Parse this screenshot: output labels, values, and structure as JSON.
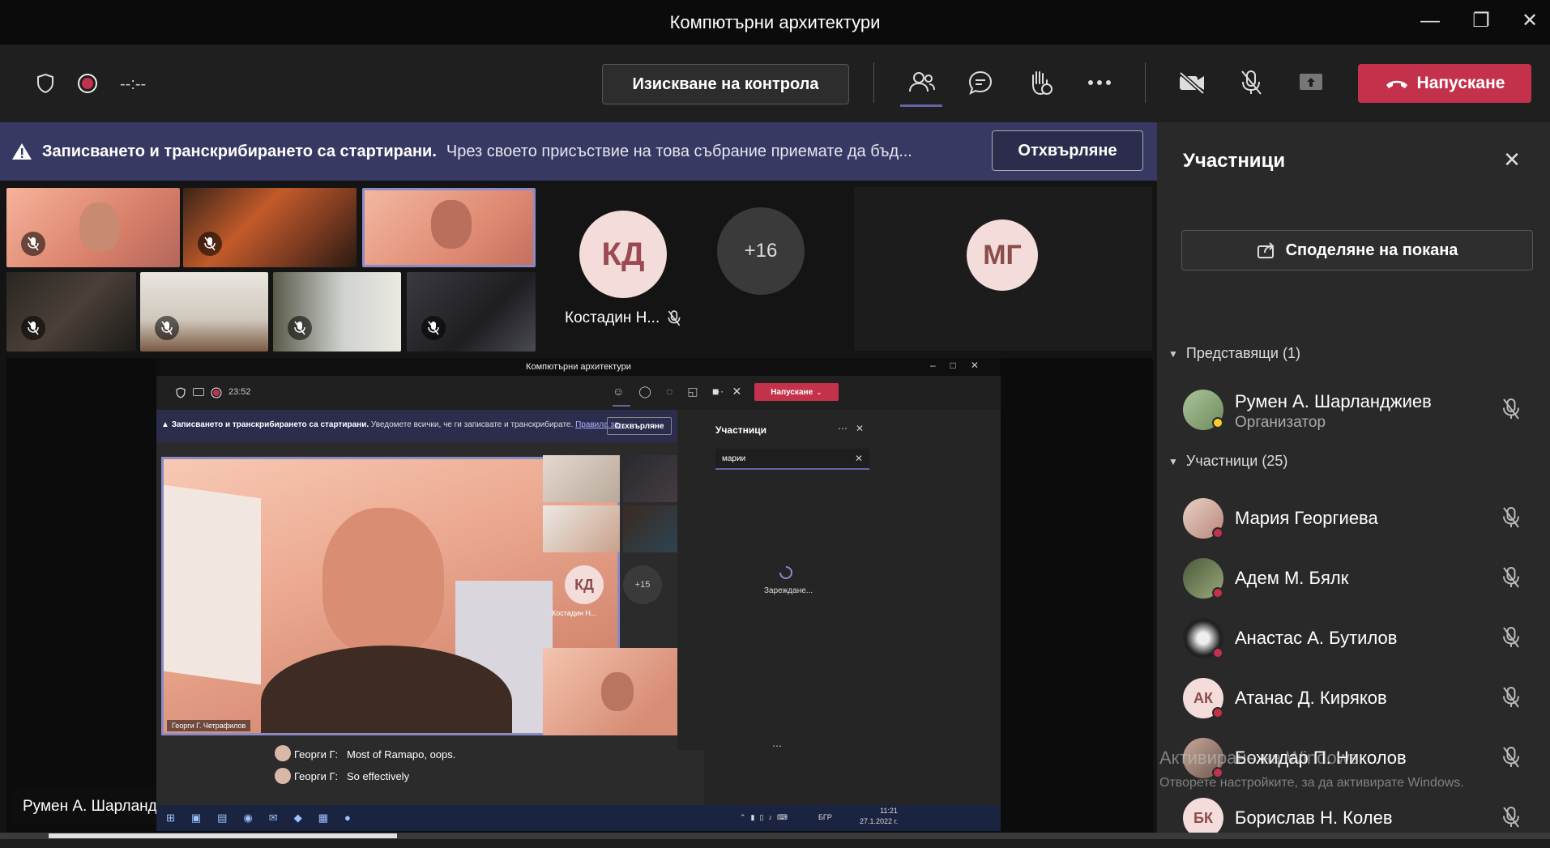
{
  "window": {
    "title": "Компютърни архитектури",
    "minimize": "—",
    "maximize": "❐",
    "close": "✕"
  },
  "toolbar": {
    "timer": "--:--",
    "request_control": "Изискване на контрола",
    "leave": "Напускане"
  },
  "banner": {
    "bold": "Записването и транскрибирането са стартирани.",
    "text": "Чрез своето присъствие на това събрание приемате да бъд...",
    "dismiss": "Отхвърляне"
  },
  "stage": {
    "avatars": [
      {
        "initials": "КД",
        "name": "Костадин Н..."
      },
      {
        "initials": "+16"
      },
      {
        "initials": "МГ"
      }
    ],
    "presenter_name": "Румен А. Шарланджиев"
  },
  "shared": {
    "title": "Компютърни архитектури",
    "timer": "23:52",
    "leave": "Напускане",
    "banner_bold": "Записването и транскрибирането са стартирани.",
    "banner_text": "Уведомете всички, че ги записвате и транскрибирате.",
    "banner_link": "Правила за...",
    "banner_dismiss": "Отхвърляне",
    "panel_title": "Участници",
    "search_value": "марии",
    "loading": "Зареждане...",
    "main_caption": "Георги Г. Четрафилов",
    "kd_initials": "КД",
    "kd_name": "Костадин Н...",
    "plus": "+15",
    "chat": [
      {
        "sender": "Георги Г:",
        "text": "Most of Ramapo, oops."
      },
      {
        "sender": "Георги Г:",
        "text": "So effectively"
      }
    ],
    "tray_lang": "БГР",
    "tray_time": "11:21",
    "tray_date": "27.1.2022 г."
  },
  "panel": {
    "title": "Участници",
    "share_invite": "Споделяне на покана",
    "presenters_header": "Представящи (1)",
    "presenter": {
      "name": "Румен А. Шарланджиев",
      "role": "Организатор"
    },
    "participants_header": "Участници (25)",
    "participants": [
      {
        "name": "Мария Георгиева"
      },
      {
        "name": "Адем М. Бялк"
      },
      {
        "name": "Анастас А. Бутилов"
      },
      {
        "name": "Атанас Д. Киряков",
        "initials": "АК"
      },
      {
        "name": "Божидар П. Николов"
      },
      {
        "name": "Борислав Н. Колев",
        "initials": "БК"
      }
    ]
  },
  "watermark": {
    "line1": "Активиране на Windows",
    "line2": "Отворете настройките, за да активирате Windows."
  },
  "colors": {
    "accent": "#6264a7",
    "leave_red": "#c4314b",
    "banner": "#373962"
  }
}
